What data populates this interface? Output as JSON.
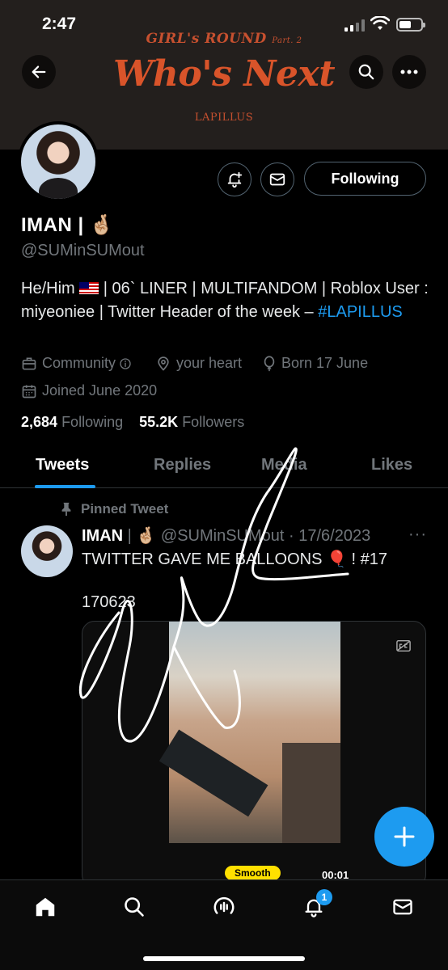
{
  "status_bar": {
    "time": "2:47",
    "battery_level": 0.55
  },
  "banner": {
    "subtitle": "GIRL's ROUND",
    "subtitle_part": "Part. 2",
    "title": "Who's Next",
    "brand": "LAPILLUS",
    "color": "#d9542a"
  },
  "profile": {
    "name": "IMAN | 🤞🏼",
    "handle": "@SUMinSUMout",
    "bio_line1": "He/Him",
    "bio_line1_rest": " | 06` LINER | MULTIFANDOM | Roblox User : miyeoniee | Twitter Header of the week –",
    "bio_hashtag": "#LAPILLUS",
    "category": "Community",
    "location": "your heart",
    "birthday": "Born 17 June",
    "joined": "Joined June 2020",
    "following_count": "2,684",
    "following_label": "Following",
    "followers_count": "55.2K",
    "followers_label": "Followers",
    "follow_button": "Following"
  },
  "tabs": [
    {
      "label": "Tweets",
      "active": true
    },
    {
      "label": "Replies",
      "active": false
    },
    {
      "label": "Media",
      "active": false
    },
    {
      "label": "Likes",
      "active": false
    }
  ],
  "tweet": {
    "pinned_label": "Pinned Tweet",
    "name": "IMAN",
    "name_emoji": "| 🤞🏼",
    "handle_date": "@SUMinSUMout · 17/6/2023",
    "text": "TWITTER GAVE ME BALLOONS 🎈 ! #17",
    "text2": "170623",
    "video_badge": "Smooth",
    "video_time": "00:01"
  },
  "nav": {
    "notification_count": "1"
  },
  "colors": {
    "accent": "#1d9bf0",
    "background": "#000000",
    "muted": "#71767b"
  }
}
